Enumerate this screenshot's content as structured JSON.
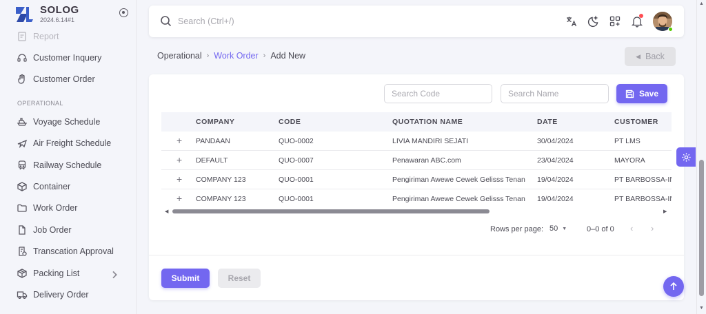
{
  "brand": {
    "name": "SOLOG",
    "version": "2024.6.14#1"
  },
  "sidebar": {
    "items_top": [
      {
        "label": "Report",
        "icon": "report-icon"
      },
      {
        "label": "Customer Inquery",
        "icon": "headset-icon"
      },
      {
        "label": "Customer Order",
        "icon": "hand-icon"
      }
    ],
    "section_label": "OPERATIONAL",
    "items": [
      {
        "label": "Voyage Schedule",
        "icon": "ship-icon"
      },
      {
        "label": "Air Freight Schedule",
        "icon": "plane-icon"
      },
      {
        "label": "Railway Schedule",
        "icon": "train-icon"
      },
      {
        "label": "Container",
        "icon": "container-icon"
      },
      {
        "label": "Work Order",
        "icon": "folder-icon"
      },
      {
        "label": "Job Order",
        "icon": "file-icon"
      },
      {
        "label": "Transcation Approval",
        "icon": "approval-icon"
      },
      {
        "label": "Packing List",
        "icon": "package-icon"
      },
      {
        "label": "Delivery Order",
        "icon": "truck-icon"
      }
    ]
  },
  "topbar": {
    "search_placeholder": "Search (Ctrl+/)"
  },
  "breadcrumb": {
    "root": "Operational",
    "parent": "Work Order",
    "current": "Add New"
  },
  "back_label": "Back",
  "filters": {
    "code_placeholder": "Search Code",
    "name_placeholder": "Search Name",
    "save_label": "Save"
  },
  "table": {
    "headers": [
      "COMPANY",
      "CODE",
      "QUOTATION NAME",
      "DATE",
      "CUSTOMER"
    ],
    "rows": [
      [
        "PANDAAN",
        "QUO-0002",
        "LIVIA MANDIRI SEJATI",
        "30/04/2024",
        "PT LMS"
      ],
      [
        "DEFAULT",
        "QUO-0007",
        "Penawaran ABC.com",
        "23/04/2024",
        "MAYORA"
      ],
      [
        "COMPANY 123",
        "QUO-0001",
        "Pengiriman Awewe Cewek Gelisss Tenan",
        "19/04/2024",
        "PT BARBOSSA-INI"
      ],
      [
        "COMPANY 123",
        "QUO-0001",
        "Pengiriman Awewe Cewek Gelisss Tenan",
        "19/04/2024",
        "PT BARBOSSA-INI"
      ]
    ]
  },
  "pagination": {
    "rows_label": "Rows per page:",
    "rows_value": "50",
    "range": "0–0 of 0"
  },
  "actions": {
    "submit_label": "Submit",
    "reset_label": "Reset"
  },
  "colors": {
    "accent": "#7367f0",
    "notification": "#ff4c51",
    "online": "#56ca00"
  }
}
